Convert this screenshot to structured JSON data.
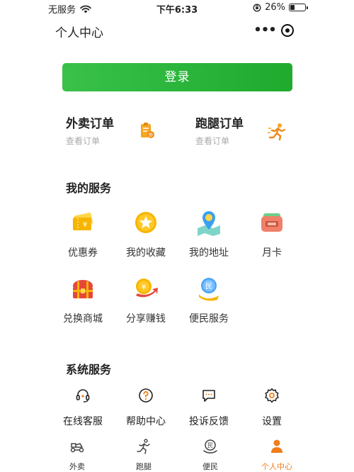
{
  "status_bar": {
    "carrier": "无服务",
    "time": "下午6:33",
    "battery": "26%",
    "battery_level": 0.26
  },
  "header": {
    "title": "个人中心"
  },
  "login": {
    "label": "登录"
  },
  "orders": [
    {
      "title": "外卖订单",
      "subtitle": "查看订单",
      "icon": "delivery-order-icon"
    },
    {
      "title": "跑腿订单",
      "subtitle": "查看订单",
      "icon": "errand-runner-icon"
    }
  ],
  "my_services": {
    "title": "我的服务",
    "items": [
      {
        "label": "优惠券",
        "icon": "coupon-icon"
      },
      {
        "label": "我的收藏",
        "icon": "star-icon"
      },
      {
        "label": "我的地址",
        "icon": "map-pin-icon"
      },
      {
        "label": "月卡",
        "icon": "monthly-card-icon"
      },
      {
        "label": "兑换商城",
        "icon": "treasure-chest-icon"
      },
      {
        "label": "分享赚钱",
        "icon": "coin-share-icon"
      },
      {
        "label": "便民服务",
        "icon": "civic-service-icon"
      }
    ]
  },
  "system_services": {
    "title": "系统服务",
    "items": [
      {
        "label": "在线客服",
        "icon": "headset-icon"
      },
      {
        "label": "帮助中心",
        "icon": "help-icon"
      },
      {
        "label": "投诉反馈",
        "icon": "feedback-icon"
      },
      {
        "label": "设置",
        "icon": "gear-icon"
      }
    ]
  },
  "tabs": [
    {
      "label": "外卖",
      "icon": "food-tab-icon"
    },
    {
      "label": "跑腿",
      "icon": "runner-tab-icon"
    },
    {
      "label": "便民",
      "icon": "civic-tab-icon"
    },
    {
      "label": "个人中心",
      "icon": "user-tab-icon",
      "active": true
    }
  ],
  "colors": {
    "accent": "#1faa2e",
    "active_tab": "#f07d1a",
    "icon_orange": "#f5a623"
  }
}
